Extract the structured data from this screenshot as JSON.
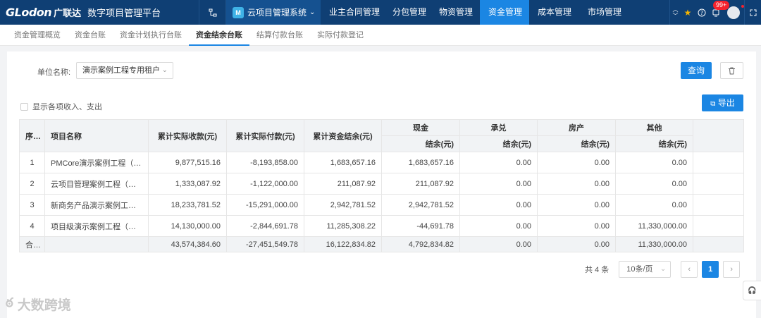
{
  "topbar": {
    "logo_text": "GLodon",
    "logo_cn": "广联达",
    "platform_title": "数字项目管理平台",
    "system_switch": {
      "icon_text": "M",
      "label": "云项目管理系统"
    },
    "nav": [
      {
        "label": "业主合同管理",
        "active": false
      },
      {
        "label": "分包管理",
        "active": false
      },
      {
        "label": "物资管理",
        "active": false
      },
      {
        "label": "资金管理",
        "active": true
      },
      {
        "label": "成本管理",
        "active": false
      },
      {
        "label": "市场管理",
        "active": false
      }
    ],
    "notification_badge": "99+"
  },
  "subtabs": [
    {
      "label": "资金管理概览",
      "active": false
    },
    {
      "label": "资金台账",
      "active": false
    },
    {
      "label": "资金计划执行台账",
      "active": false
    },
    {
      "label": "资金结余台账",
      "active": true
    },
    {
      "label": "结算付款台账",
      "active": false
    },
    {
      "label": "实际付款登记",
      "active": false
    }
  ],
  "filter": {
    "label": "单位名称:",
    "value": "演示案例工程专用租户",
    "query_button": "查询",
    "show_items_label": "显示各项收入、支出",
    "export_button": "导出"
  },
  "table": {
    "headers": {
      "index": "序号",
      "name": "项目名称",
      "income": "累计实际收款(元)",
      "payment": "累计实际付款(元)",
      "balance": "累计资金结余(元)",
      "cash": "现金",
      "acceptance": "承兑",
      "property": "房产",
      "other": "其他",
      "sub_balance": "结余(元)"
    },
    "rows": [
      {
        "index": "1",
        "name": "PMCore演示案例工程（演…",
        "income": "9,877,515.16",
        "payment": "-8,193,858.00",
        "balance": "1,683,657.16",
        "cash": "1,683,657.16",
        "acceptance": "0.00",
        "property": "0.00",
        "other": "0.00"
      },
      {
        "index": "2",
        "name": "云项目管理案例工程（演…",
        "income": "1,333,087.92",
        "payment": "-1,122,000.00",
        "balance": "211,087.92",
        "cash": "211,087.92",
        "acceptance": "0.00",
        "property": "0.00",
        "other": "0.00"
      },
      {
        "index": "3",
        "name": "新商务产品演示案例工程…",
        "income": "18,233,781.52",
        "payment": "-15,291,000.00",
        "balance": "2,942,781.52",
        "cash": "2,942,781.52",
        "acceptance": "0.00",
        "property": "0.00",
        "other": "0.00"
      },
      {
        "index": "4",
        "name": "项目级演示案例工程（勿…",
        "income": "14,130,000.00",
        "payment": "-2,844,691.78",
        "balance": "11,285,308.22",
        "cash": "-44,691.78",
        "acceptance": "0.00",
        "property": "0.00",
        "other": "11,330,000.00"
      }
    ],
    "total": {
      "label": "合计",
      "income": "43,574,384.60",
      "payment": "-27,451,549.78",
      "balance": "16,122,834.82",
      "cash": "4,792,834.82",
      "acceptance": "0.00",
      "property": "0.00",
      "other": "11,330,000.00"
    }
  },
  "pagination": {
    "total_text": "共 4 条",
    "page_size": "10条/页",
    "current_page": "1"
  },
  "watermark": "大数跨境"
}
